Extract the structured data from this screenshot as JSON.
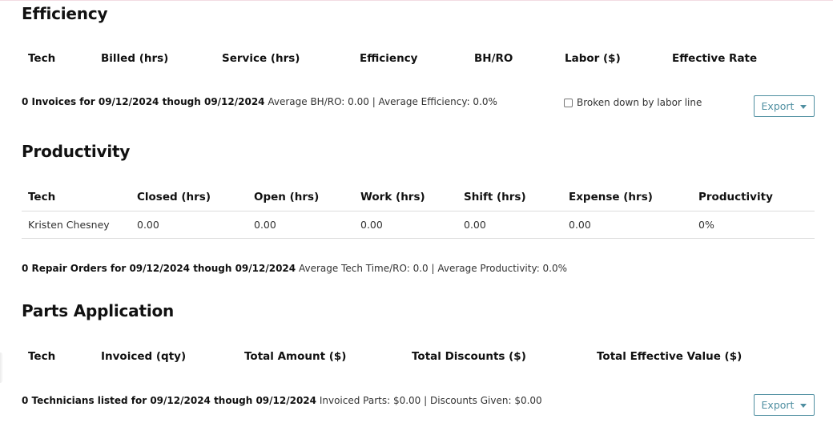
{
  "efficiency": {
    "title": "Efficiency",
    "columns": [
      "Tech",
      "Billed (hrs)",
      "Service (hrs)",
      "Efficiency",
      "BH/RO",
      "Labor ($)",
      "Effective Rate"
    ],
    "summary_bold": "0 Invoices for 09/12/2024 though 09/12/2024",
    "summary_rest": " Average BH/RO: 0.00 | Average Efficiency: 0.0%",
    "checkbox_label": "Broken down by labor line",
    "checkbox_checked": false,
    "export_label": "Export"
  },
  "productivity": {
    "title": "Productivity",
    "columns": [
      "Tech",
      "Closed (hrs)",
      "Open (hrs)",
      "Work (hrs)",
      "Shift (hrs)",
      "Expense (hrs)",
      "Productivity"
    ],
    "rows": [
      [
        "Kristen Chesney",
        "0.00",
        "0.00",
        "0.00",
        "0.00",
        "0.00",
        "0%"
      ]
    ],
    "summary_bold": "0 Repair Orders for 09/12/2024 though 09/12/2024",
    "summary_rest": " Average Tech Time/RO: 0.0 | Average Productivity: 0.0%"
  },
  "parts": {
    "title": "Parts Application",
    "columns": [
      "Tech",
      "Invoiced (qty)",
      "Total Amount ($)",
      "Total Discounts ($)",
      "Total Effective Value ($)"
    ],
    "summary_bold": "0 Technicians listed for 09/12/2024 though 09/12/2024",
    "summary_rest": " Invoiced Parts: $0.00 | Discounts Given: $0.00",
    "export_label": "Export"
  },
  "colors": {
    "accent": "#4f8fa1",
    "divider": "#dcdcdc"
  }
}
